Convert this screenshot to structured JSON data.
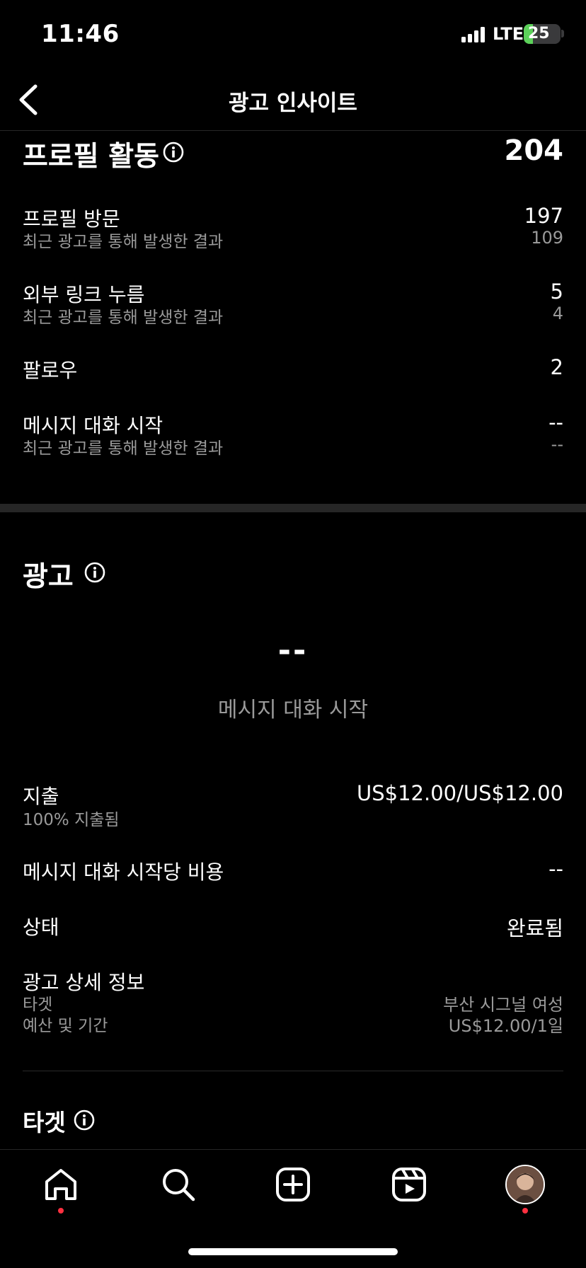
{
  "status_bar": {
    "time": "11:46",
    "network": "LTE",
    "battery": "25",
    "battery_level": 0.25
  },
  "header": {
    "title": "광고 인사이트"
  },
  "profile_activity": {
    "title": "프로필 활동",
    "total": "204",
    "rows": [
      {
        "label": "프로필 방문",
        "sub": "최근 광고를 통해 발생한 결과",
        "value": "197",
        "sub_value": "109"
      },
      {
        "label": "외부 링크 누름",
        "sub": "최근 광고를 통해 발생한 결과",
        "value": "5",
        "sub_value": "4"
      },
      {
        "label": "팔로우",
        "value": "2"
      },
      {
        "label": "메시지 대화 시작",
        "sub": "최근 광고를 통해 발생한 결과",
        "value": "--",
        "sub_value": "--"
      }
    ]
  },
  "ad": {
    "title": "광고",
    "highlight_value": "--",
    "highlight_caption": "메시지 대화 시작",
    "spend": {
      "label": "지출",
      "sub": "100% 지출됨",
      "value": "US$12.00/US$12.00"
    },
    "cost_per": {
      "label": "메시지 대화 시작당 비용",
      "value": "--"
    },
    "status": {
      "label": "상태",
      "value": "완료됨"
    },
    "details": {
      "label": "광고 상세 정보",
      "target_label": "타겟",
      "target_value": "부산 시그널 여성",
      "budget_label": "예산 및 기간",
      "budget_value": "US$12.00/1일"
    }
  },
  "target_section": {
    "title": "타겟"
  },
  "nav": {
    "items": [
      "home-icon",
      "search-icon",
      "create-icon",
      "reels-icon",
      "profile-avatar"
    ]
  },
  "colors": {
    "background": "#000000",
    "secondary_text": "#9a9a9a",
    "notification": "#ff3040",
    "battery": "#5cd15a"
  }
}
